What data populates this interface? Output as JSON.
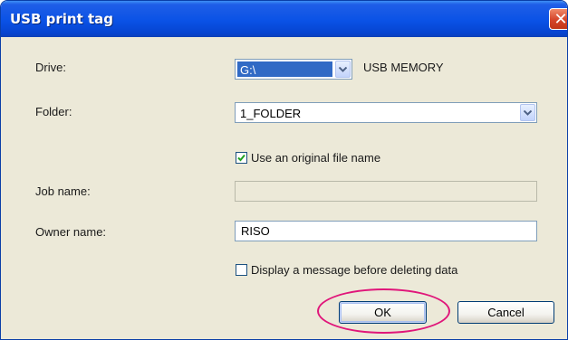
{
  "window": {
    "title": "USB print tag",
    "close_glyph": "✕"
  },
  "drive": {
    "label": "Drive:",
    "value": "G:\\",
    "device": "USB MEMORY"
  },
  "folder": {
    "label": "Folder:",
    "value": "1_FOLDER"
  },
  "use_original": {
    "label": "Use an original file name",
    "checked": true
  },
  "job_name": {
    "label": "Job name:",
    "value": ""
  },
  "owner_name": {
    "label": "Owner name:",
    "value": "RISO"
  },
  "display_message": {
    "label": "Display a message before deleting data",
    "checked": false
  },
  "buttons": {
    "ok": "OK",
    "cancel": "Cancel"
  },
  "colors": {
    "title_bar": "#0a52e6",
    "highlight": "#e0167a",
    "selection": "#316ac5"
  }
}
